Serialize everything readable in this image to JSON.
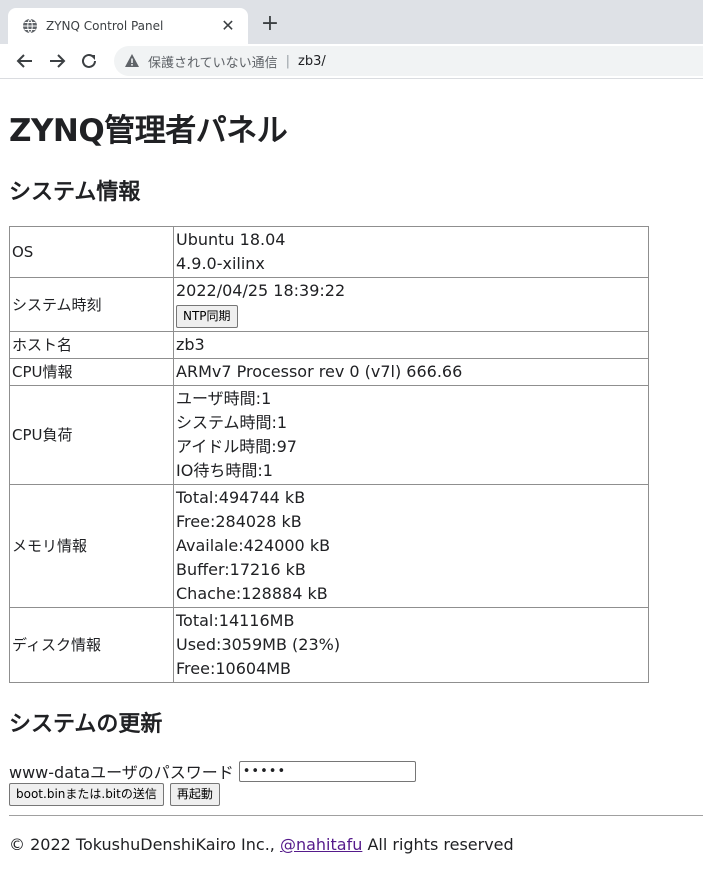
{
  "browser": {
    "tab_title": "ZYNQ Control Panel",
    "tab_close": "✕",
    "new_tab": "+",
    "security_text": "保護されていない通信",
    "address_sep": "|",
    "url": "zb3/"
  },
  "page": {
    "title": "ZYNQ管理者パネル",
    "system_info_heading": "システム情報",
    "system_info": {
      "os": {
        "label": "OS",
        "lines": [
          "Ubuntu 18.04",
          "4.9.0-xilinx"
        ]
      },
      "time": {
        "label": "システム時刻",
        "value": "2022/04/25 18:39:22",
        "ntp_button": "NTP同期"
      },
      "host": {
        "label": "ホスト名",
        "value": "zb3"
      },
      "cpu_info": {
        "label": "CPU情報",
        "value": "ARMv7 Processor rev 0 (v7l) 666.66"
      },
      "cpu_load": {
        "label": "CPU負荷",
        "lines": [
          "ユーザ時間:1",
          "システム時間:1",
          "アイドル時間:97",
          "IO待ち時間:1"
        ]
      },
      "memory": {
        "label": "メモリ情報",
        "lines": [
          "Total:494744 kB",
          "Free:284028 kB",
          "Availale:424000 kB",
          "Buffer:17216 kB",
          "Chache:128884 kB"
        ]
      },
      "disk": {
        "label": "ディスク情報",
        "lines": [
          "Total:14116MB",
          "Used:3059MB (23%)",
          "Free:10604MB"
        ]
      }
    },
    "update_heading": "システムの更新",
    "password_label": "www-dataユーザのパスワード",
    "password_value": "•••••",
    "send_button": "boot.binまたは.bitの送信",
    "reboot_button": "再起動",
    "footer": {
      "prefix": "© 2022 TokushuDenshiKairo Inc., ",
      "link": "@nahitafu",
      "suffix": " All rights reserved"
    }
  }
}
